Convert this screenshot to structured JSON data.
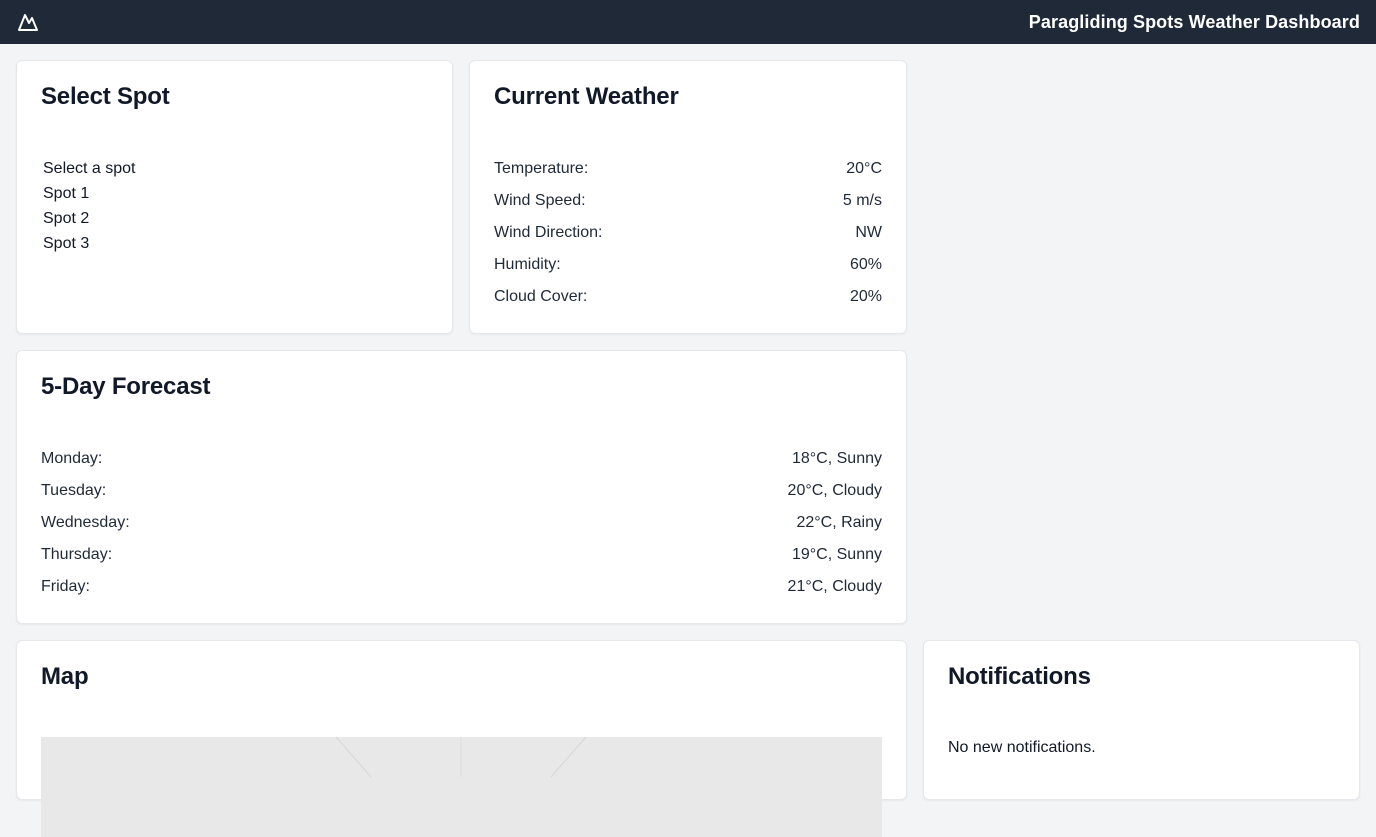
{
  "header": {
    "title": "Paragliding Spots Weather Dashboard",
    "logo_icon": "mountain-icon"
  },
  "select_spot": {
    "title": "Select Spot",
    "options": [
      "Select a spot",
      "Spot 1",
      "Spot 2",
      "Spot 3"
    ]
  },
  "current_weather": {
    "title": "Current Weather",
    "rows": [
      {
        "label": "Temperature:",
        "value": "20°C"
      },
      {
        "label": "Wind Speed:",
        "value": "5 m/s"
      },
      {
        "label": "Wind Direction:",
        "value": "NW"
      },
      {
        "label": "Humidity:",
        "value": "60%"
      },
      {
        "label": "Cloud Cover:",
        "value": "20%"
      }
    ]
  },
  "forecast": {
    "title": "5-Day Forecast",
    "rows": [
      {
        "label": "Monday:",
        "value": "18°C, Sunny"
      },
      {
        "label": "Tuesday:",
        "value": "20°C, Cloudy"
      },
      {
        "label": "Wednesday:",
        "value": "22°C, Rainy"
      },
      {
        "label": "Thursday:",
        "value": "19°C, Sunny"
      },
      {
        "label": "Friday:",
        "value": "21°C, Cloudy"
      }
    ]
  },
  "map": {
    "title": "Map"
  },
  "notifications": {
    "title": "Notifications",
    "message": "No new notifications."
  },
  "colors": {
    "topbar": "#1f2937",
    "background": "#f3f4f6",
    "card": "#ffffff"
  }
}
